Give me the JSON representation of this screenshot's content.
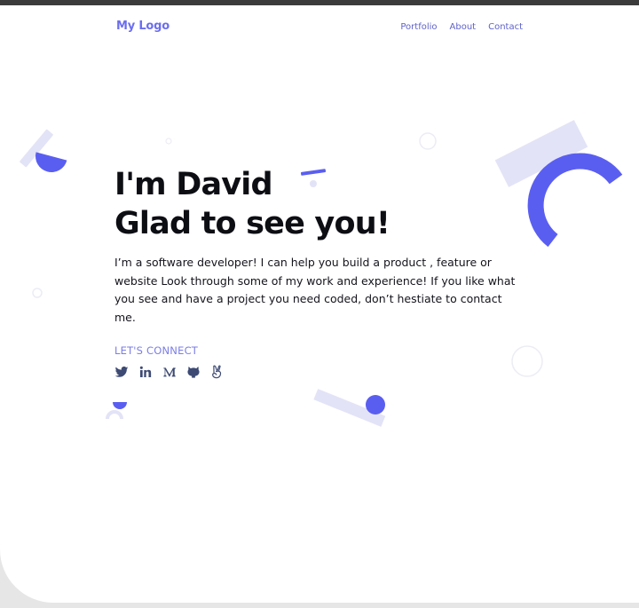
{
  "header": {
    "logo": "My Logo",
    "nav": [
      {
        "label": "Portfolio"
      },
      {
        "label": "About"
      },
      {
        "label": "Contact"
      }
    ]
  },
  "hero": {
    "headline_line1": "I'm David",
    "headline_line2": "Glad to see you!",
    "intro": "I’m a software developer! I can help you build a product , feature or website Look through some of my work and experience! If you like what you see and have a project you need coded, don’t hestiate to contact me."
  },
  "connect": {
    "label": "LET'S CONNECT",
    "socials": [
      {
        "icon": "twitter-icon"
      },
      {
        "icon": "linkedin-icon"
      },
      {
        "icon": "medium-icon"
      },
      {
        "icon": "github-icon"
      },
      {
        "icon": "angellist-icon"
      }
    ]
  },
  "colors": {
    "accent": "#5a5ef0",
    "accent_light": "#e3e3f7",
    "text": "#0d0d14",
    "link": "#5f62c9",
    "icon": "#3d4a74"
  }
}
